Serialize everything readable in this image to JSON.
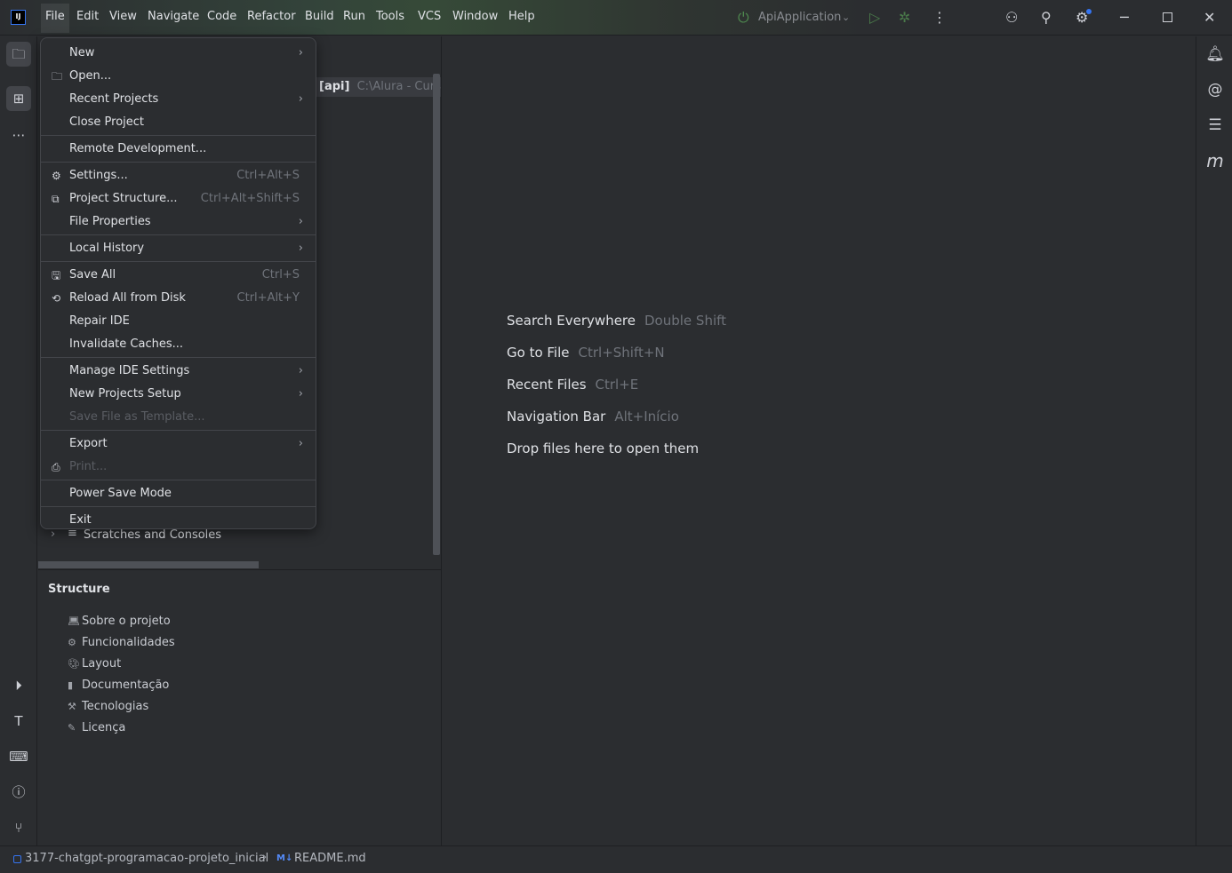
{
  "titlebar": {
    "menus": [
      "File",
      "Edit",
      "View",
      "Navigate",
      "Code",
      "Refactor",
      "Build",
      "Run",
      "Tools",
      "VCS",
      "Window",
      "Help"
    ],
    "run_config": "ApiApplication"
  },
  "project": {
    "path_label": "[api]",
    "path": "C:\\Alura - Curso\\",
    "scratches": "Scratches and Consoles"
  },
  "file_menu": [
    {
      "label": "New",
      "arrow": true
    },
    {
      "label": "Open...",
      "icon": "folder-icon"
    },
    {
      "label": "Recent Projects",
      "arrow": true
    },
    {
      "label": "Close Project",
      "sep_after": true
    },
    {
      "label": "Remote Development...",
      "sep_after": true
    },
    {
      "label": "Settings...",
      "icon": "gear-icon",
      "shortcut": "Ctrl+Alt+S"
    },
    {
      "label": "Project Structure...",
      "icon": "project-structure-icon",
      "shortcut": "Ctrl+Alt+Shift+S"
    },
    {
      "label": "File Properties",
      "arrow": true,
      "sep_after": true
    },
    {
      "label": "Local History",
      "arrow": true,
      "sep_after": true
    },
    {
      "label": "Save All",
      "icon": "save-icon",
      "shortcut": "Ctrl+S"
    },
    {
      "label": "Reload All from Disk",
      "icon": "reload-icon",
      "shortcut": "Ctrl+Alt+Y"
    },
    {
      "label": "Repair IDE"
    },
    {
      "label": "Invalidate Caches...",
      "sep_after": true
    },
    {
      "label": "Manage IDE Settings",
      "arrow": true
    },
    {
      "label": "New Projects Setup",
      "arrow": true
    },
    {
      "label": "Save File as Template...",
      "disabled": true,
      "sep_after": true
    },
    {
      "label": "Export",
      "arrow": true
    },
    {
      "label": "Print...",
      "icon": "print-icon",
      "disabled": true,
      "sep_after": true
    },
    {
      "label": "Power Save Mode",
      "sep_after": true
    },
    {
      "label": "Exit"
    }
  ],
  "structure": {
    "title": "Structure",
    "items": [
      {
        "label": "Sobre o projeto",
        "icon": "laptop-icon"
      },
      {
        "label": "Funcionalidades",
        "icon": "gear-icon"
      },
      {
        "label": "Layout",
        "icon": "palette-icon"
      },
      {
        "label": "Documentação",
        "icon": "document-icon"
      },
      {
        "label": "Tecnologias",
        "icon": "tools-icon"
      },
      {
        "label": "Licença",
        "icon": "memo-icon"
      }
    ]
  },
  "editor": {
    "hints": [
      {
        "label": "Search Everywhere",
        "key": "Double Shift"
      },
      {
        "label": "Go to File",
        "key": "Ctrl+Shift+N"
      },
      {
        "label": "Recent Files",
        "key": "Ctrl+E"
      },
      {
        "label": "Navigation Bar",
        "key": "Alt+Início"
      },
      {
        "label": "Drop files here to open them",
        "key": ""
      }
    ]
  },
  "statusbar": {
    "project": "3177-chatgpt-programacao-projeto_inicial",
    "file": "README.md",
    "file_badge": "M↓"
  }
}
